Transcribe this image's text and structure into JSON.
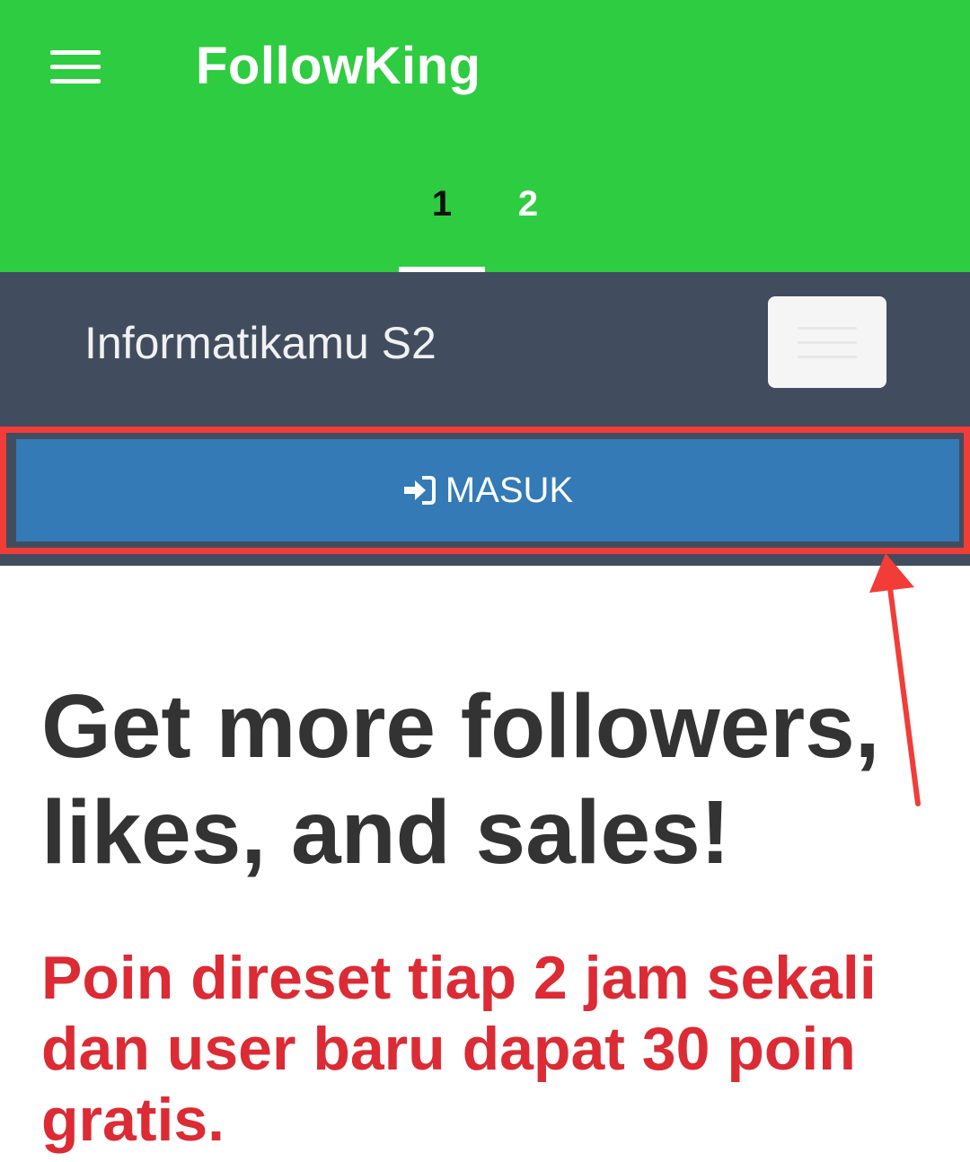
{
  "appbar": {
    "title": "FollowKing",
    "menu_icon": "hamburger-menu-icon",
    "background_color": "#2ecc40",
    "tabs": [
      {
        "label": "1",
        "active": true
      },
      {
        "label": "2",
        "active": false
      }
    ]
  },
  "navbar": {
    "brand": "Informatikamu S2",
    "toggler_icon": "hamburger-menu-icon",
    "background_color": "#414d5f"
  },
  "login": {
    "label": "MASUK",
    "icon": "sign-in-icon",
    "button_color": "#337ab7",
    "highlight_color": "#f23c37"
  },
  "content": {
    "headline": "Get more followers, likes, and sales!",
    "notice": "Poin direset tiap 2 jam sekali dan user baru dapat 30 poin gratis.",
    "notice_color": "#dc2b34"
  }
}
